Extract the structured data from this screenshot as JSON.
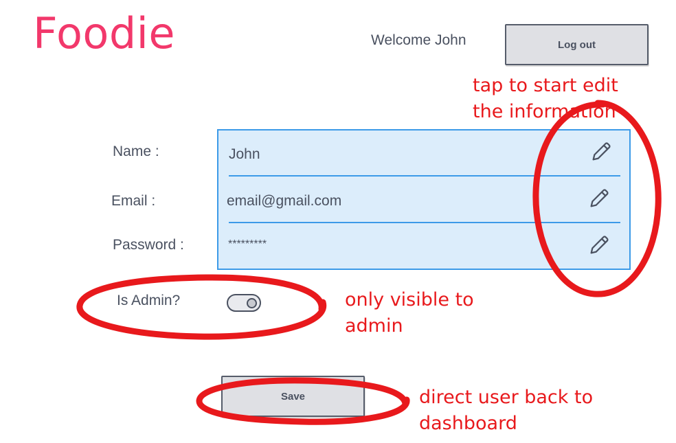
{
  "header": {
    "logo": "Foodie",
    "welcome": "Welcome John",
    "logout_label": "Log out"
  },
  "form": {
    "fields": [
      {
        "label": "Name :",
        "value": "John"
      },
      {
        "label": "Email :",
        "value": "email@gmail.com"
      },
      {
        "label": "Password :",
        "value": "*********"
      }
    ],
    "admin_label": "Is Admin?",
    "admin_toggle_on": true,
    "save_label": "Save"
  },
  "annotations": {
    "edit_note": [
      "tap to start edit",
      "the information"
    ],
    "admin_note": [
      "only visible to",
      "admin"
    ],
    "save_note": [
      "direct user back to",
      "dashboard"
    ],
    "color": "#e8191c"
  },
  "colors": {
    "brand": "#f2386b",
    "panel_fill": "#dcedfb",
    "panel_border": "#3c9ae8",
    "button_fill": "#dfe0e4",
    "text": "#4a5160"
  }
}
